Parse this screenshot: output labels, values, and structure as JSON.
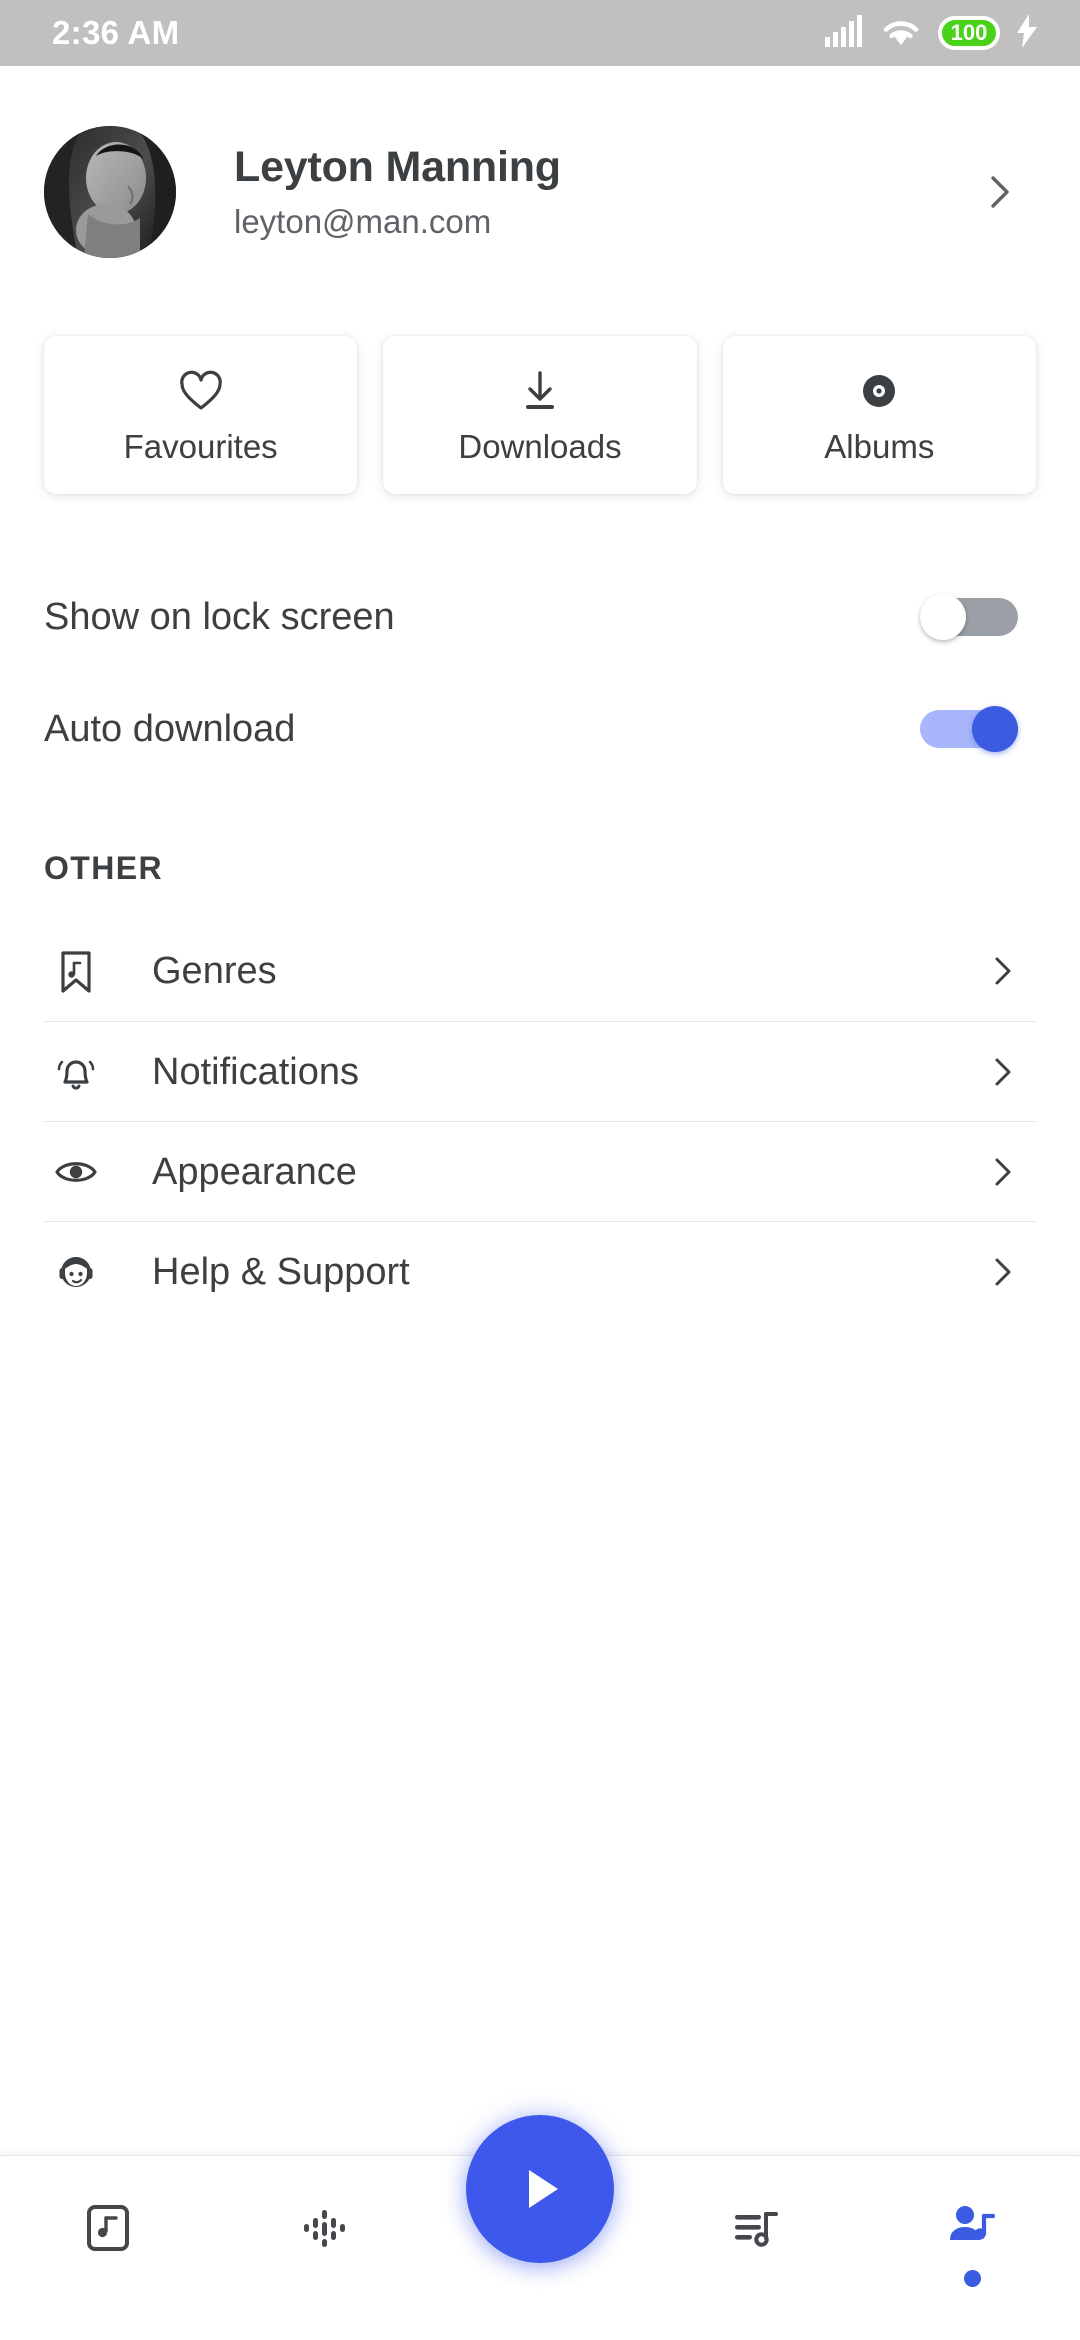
{
  "status_bar": {
    "time": "2:36 AM",
    "battery_level": "100",
    "battery_color": "#4ad11a",
    "icons": [
      "signal-bars-icon",
      "wifi-icon",
      "battery-icon",
      "charging-bolt-icon"
    ]
  },
  "profile": {
    "name": "Leyton Manning",
    "email": "leyton@man.com",
    "avatar_alt": "avatar",
    "chevron": "chevron-right-icon"
  },
  "quick_cards": [
    {
      "label": "Favourites",
      "icon": "heart-icon"
    },
    {
      "label": "Downloads",
      "icon": "download-icon"
    },
    {
      "label": "Albums",
      "icon": "vinyl-disc-icon"
    }
  ],
  "toggles": [
    {
      "label": "Show on lock screen",
      "state": "off"
    },
    {
      "label": "Auto download",
      "state": "on"
    }
  ],
  "other_section": {
    "heading": "OTHER",
    "items": [
      {
        "label": "Genres",
        "icon": "bookmark-music-icon"
      },
      {
        "label": "Notifications",
        "icon": "bell-ring-icon"
      },
      {
        "label": "Appearance",
        "icon": "eye-icon"
      },
      {
        "label": "Help & Support",
        "icon": "support-agent-icon"
      }
    ]
  },
  "player": {
    "fab_icon": "play-icon",
    "fab_color": "#3d58ea"
  },
  "bottom_nav": {
    "active_color": "#3b5be0",
    "inactive_color": "#44474b",
    "items": [
      {
        "icon": "music-square-icon",
        "active": false
      },
      {
        "icon": "podcast-waveform-icon",
        "active": false
      },
      {
        "icon": "playlist-music-icon",
        "active": false
      },
      {
        "icon": "profile-music-icon",
        "active": true
      }
    ]
  }
}
